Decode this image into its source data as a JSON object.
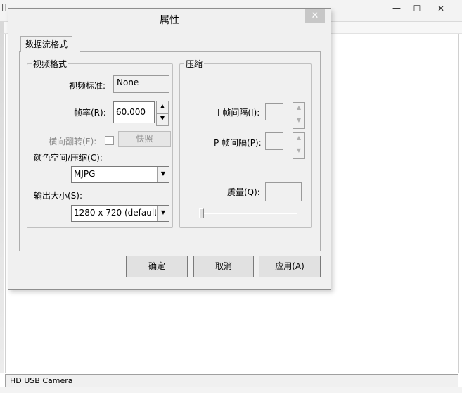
{
  "main_window": {
    "title": "",
    "status_text": "HD USB Camera",
    "win_buttons": {
      "minimize": "—",
      "maximize": "☐",
      "close": "✕"
    }
  },
  "dialog": {
    "title": "属性",
    "close_glyph": "✕",
    "tab_label": "数据流格式",
    "video_group": {
      "label": "视频格式",
      "standard_label": "视频标准:",
      "standard_value": "None",
      "framerate_label": "帧率(R):",
      "framerate_value": "60.000",
      "flip_label": "横向翻转(F):",
      "snapshot_label": "快照",
      "colorspace_label": "颜色空间/压缩(C):",
      "colorspace_value": "MJPG",
      "output_size_label": "输出大小(S):",
      "output_size_value": "1280 x 720  (default)"
    },
    "compression_group": {
      "label": "压缩",
      "i_frame_label": "I 帧间隔(I):",
      "p_frame_label": "P 帧间隔(P):",
      "quality_label": "质量(Q):",
      "quality_slider_fraction": 0.0
    },
    "buttons": {
      "ok": "确定",
      "cancel": "取消",
      "apply": "应用(A)"
    },
    "spin_glyphs": {
      "up": "▲",
      "down": "▼"
    },
    "combo_arrow": "▼"
  }
}
